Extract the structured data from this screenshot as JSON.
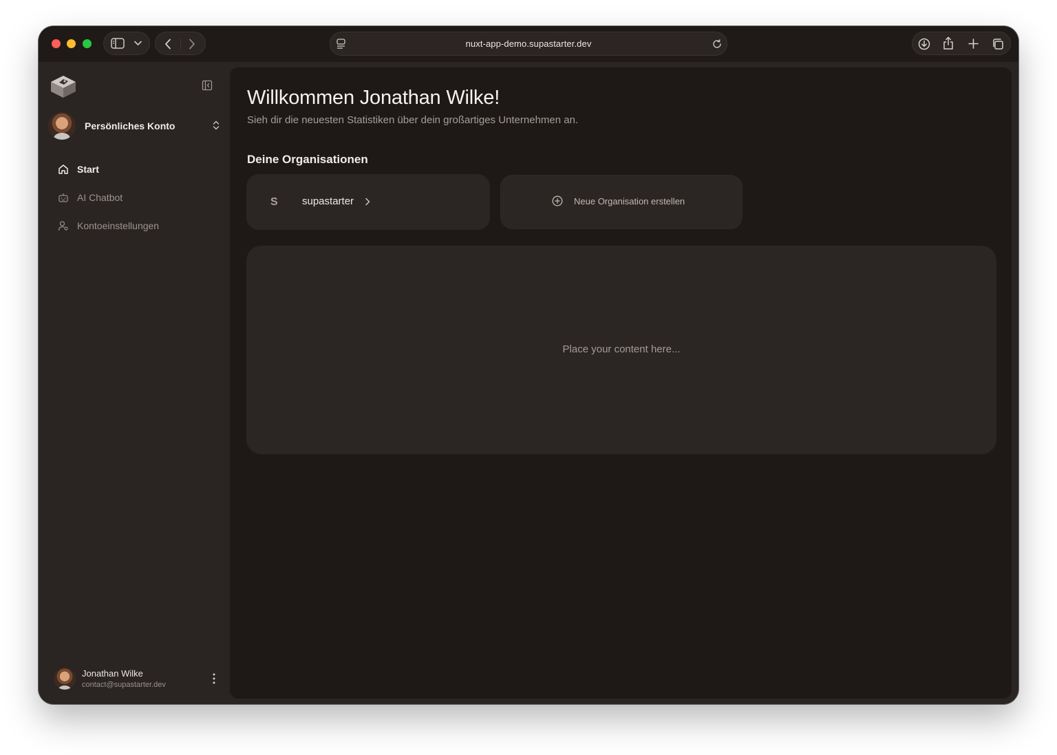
{
  "browser": {
    "url": "nuxt-app-demo.supastarter.dev",
    "icons": [
      "sidebar-icon",
      "chevron-down-icon",
      "back-icon",
      "forward-icon",
      "page-settings-icon",
      "reload-icon",
      "download-icon",
      "share-icon",
      "new-tab-icon",
      "tabs-overview-icon"
    ]
  },
  "sidebar": {
    "account_label": "Persönliches Konto",
    "nav": [
      {
        "label": "Start",
        "icon": "home-icon",
        "active": true
      },
      {
        "label": "AI Chatbot",
        "icon": "bot-icon",
        "active": false
      },
      {
        "label": "Kontoeinstellungen",
        "icon": "user-settings-icon",
        "active": false
      }
    ],
    "user": {
      "name": "Jonathan Wilke",
      "email": "contact@supastarter.dev"
    }
  },
  "main": {
    "title": "Willkommen Jonathan Wilke!",
    "subtitle": "Sieh dir die neuesten Statistiken über dein großartiges Unternehmen an.",
    "organizations_heading": "Deine Organisationen",
    "organizations": [
      {
        "initial": "S",
        "name": "supastarter"
      }
    ],
    "new_org_label": "Neue Organisation erstellen",
    "placeholder": "Place your content here..."
  },
  "colors": {
    "sidebar_bg": "#2a2422",
    "main_bg": "#1e1917",
    "card_bg": "#2b2523"
  }
}
